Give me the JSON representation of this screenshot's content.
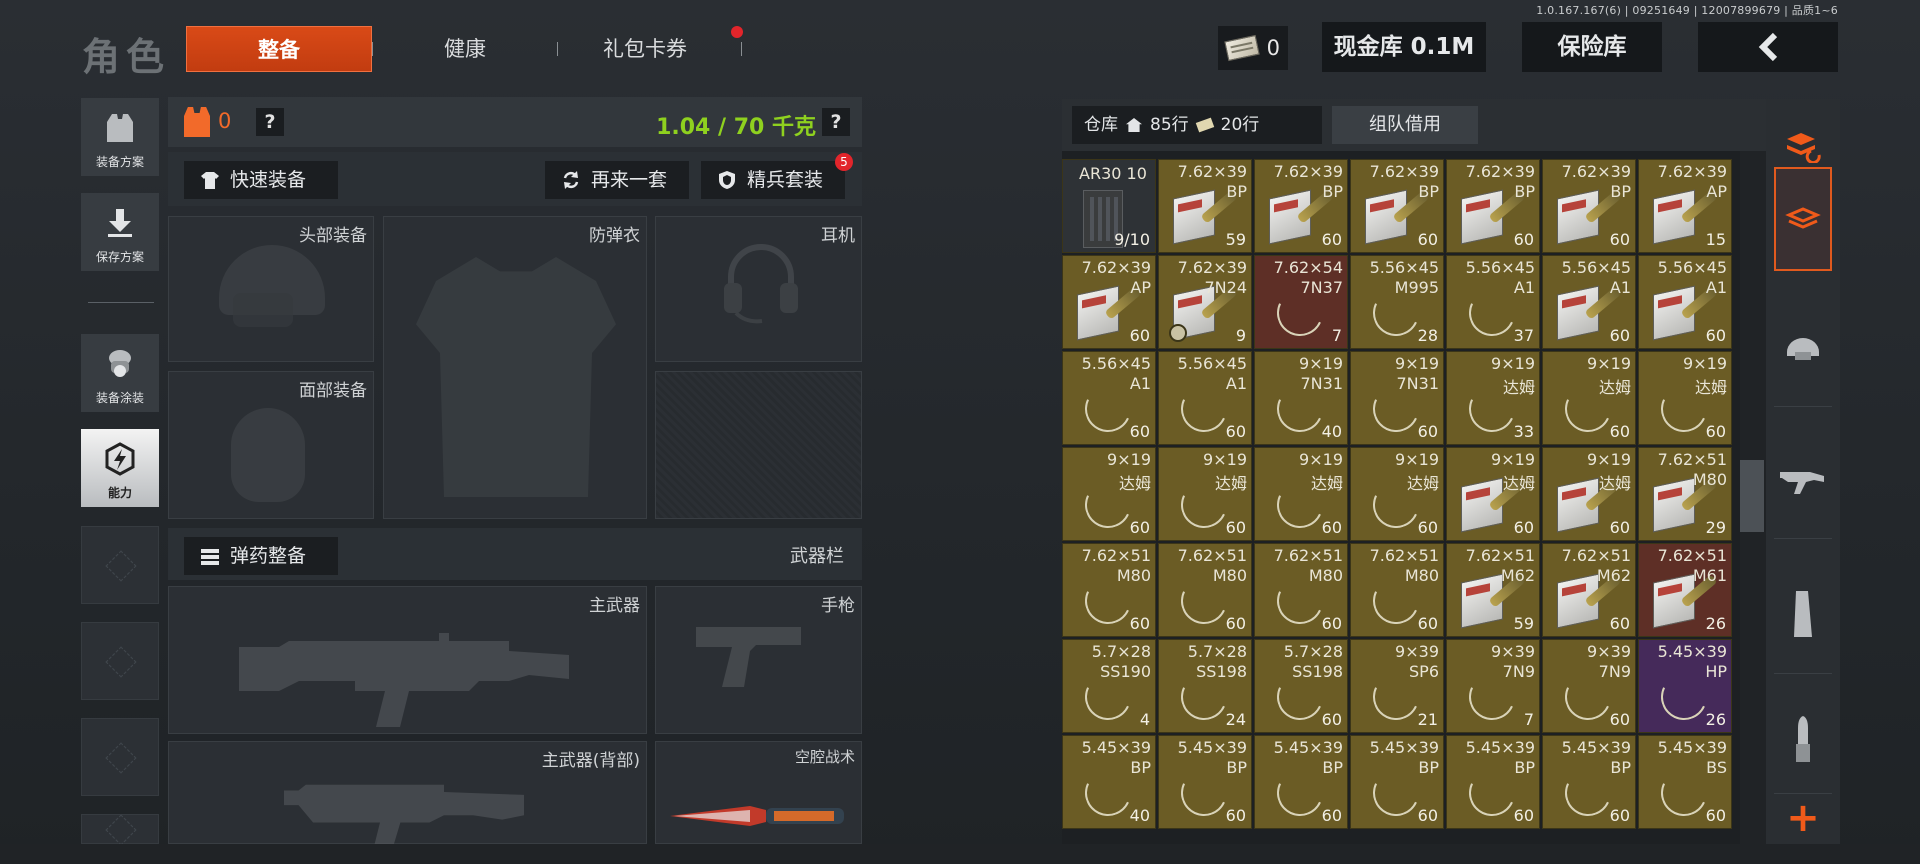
{
  "version_text": "1.0.167.167(6) | 09251649 | 12007899679 | 品质1~6",
  "header": {
    "page_title": "角色",
    "tabs": [
      {
        "label": "整备",
        "active": true
      },
      {
        "label": "健康",
        "active": false
      },
      {
        "label": "礼包卡券",
        "active": false,
        "has_notification": true
      }
    ],
    "money_value": "0",
    "cash_button": "现金库 0.1M",
    "safe_button": "保险库",
    "back_icon": "chevron-left-icon"
  },
  "left_rail": {
    "items": [
      {
        "label": "装备方案",
        "icon": "vest-icon"
      },
      {
        "label": "保存方案",
        "icon": "download-icon"
      },
      {
        "label": "装备涂装",
        "icon": "soldier-icon"
      },
      {
        "label": "能力",
        "icon": "ability-icon",
        "active": true
      }
    ]
  },
  "equipment": {
    "armor_count": "0",
    "help_label": "?",
    "weight": "1.04 / 70 千克",
    "quick_equip": "快速装备",
    "repeat_set": "再来一套",
    "elite_set": "精兵套装",
    "elite_badge": "5",
    "slots": {
      "head": "头部装备",
      "armor": "防弹衣",
      "headset": "耳机",
      "face": "面部装备"
    },
    "ammo_button": "弹药整备",
    "weapons_label": "武器栏",
    "weapon_slots": {
      "primary": "主武器",
      "pistol": "手枪",
      "primary_back": "主武器(背部)",
      "melee": "空腔战术"
    }
  },
  "warehouse": {
    "tab_label": "仓库",
    "rows_house": "85行",
    "rows_ticket": "20行",
    "borrow_label": "组队借用",
    "colors": {
      "gold": "#6b5c25",
      "gray": "#2e3236",
      "red": "#5e2f26",
      "purple": "#452a5a"
    },
    "items": [
      {
        "cal": "AR30",
        "type": "10",
        "qty": "9/10",
        "art": "mag",
        "color": "gray"
      },
      {
        "cal": "7.62×39",
        "type": "BP",
        "qty": "59",
        "art": "box",
        "color": "gold"
      },
      {
        "cal": "7.62×39",
        "type": "BP",
        "qty": "60",
        "art": "box",
        "color": "gold"
      },
      {
        "cal": "7.62×39",
        "type": "BP",
        "qty": "60",
        "art": "box",
        "color": "gold"
      },
      {
        "cal": "7.62×39",
        "type": "BP",
        "qty": "60",
        "art": "box",
        "color": "gold"
      },
      {
        "cal": "7.62×39",
        "type": "BP",
        "qty": "60",
        "art": "box",
        "color": "gold"
      },
      {
        "cal": "7.62×39",
        "type": "AP",
        "qty": "15",
        "art": "box",
        "color": "gold"
      },
      {
        "cal": "7.62×39",
        "type": "AP",
        "qty": "60",
        "art": "box",
        "color": "gold"
      },
      {
        "cal": "7.62×39",
        "type": "7N24",
        "qty": "9",
        "art": "box",
        "color": "gold",
        "badge": true
      },
      {
        "cal": "7.62×54",
        "type": "7N37",
        "qty": "7",
        "art": "ring",
        "color": "red"
      },
      {
        "cal": "5.56×45",
        "type": "M995",
        "qty": "28",
        "art": "ring",
        "color": "gold"
      },
      {
        "cal": "5.56×45",
        "type": "A1",
        "qty": "37",
        "art": "ring",
        "color": "gold"
      },
      {
        "cal": "5.56×45",
        "type": "A1",
        "qty": "60",
        "art": "box",
        "color": "gold"
      },
      {
        "cal": "5.56×45",
        "type": "A1",
        "qty": "60",
        "art": "box",
        "color": "gold"
      },
      {
        "cal": "5.56×45",
        "type": "A1",
        "qty": "60",
        "art": "ring",
        "color": "gold"
      },
      {
        "cal": "5.56×45",
        "type": "A1",
        "qty": "60",
        "art": "ring",
        "color": "gold"
      },
      {
        "cal": "9×19",
        "type": "7N31",
        "qty": "40",
        "art": "ring",
        "color": "gold"
      },
      {
        "cal": "9×19",
        "type": "7N31",
        "qty": "60",
        "art": "ring",
        "color": "gold"
      },
      {
        "cal": "9×19",
        "type": "达姆",
        "qty": "33",
        "art": "ring",
        "color": "gold"
      },
      {
        "cal": "9×19",
        "type": "达姆",
        "qty": "60",
        "art": "ring",
        "color": "gold"
      },
      {
        "cal": "9×19",
        "type": "达姆",
        "qty": "60",
        "art": "ring",
        "color": "gold"
      },
      {
        "cal": "9×19",
        "type": "达姆",
        "qty": "60",
        "art": "ring",
        "color": "gold"
      },
      {
        "cal": "9×19",
        "type": "达姆",
        "qty": "60",
        "art": "ring",
        "color": "gold"
      },
      {
        "cal": "9×19",
        "type": "达姆",
        "qty": "60",
        "art": "ring",
        "color": "gold"
      },
      {
        "cal": "9×19",
        "type": "达姆",
        "qty": "60",
        "art": "ring",
        "color": "gold"
      },
      {
        "cal": "9×19",
        "type": "达姆",
        "qty": "60",
        "art": "box",
        "color": "gold"
      },
      {
        "cal": "9×19",
        "type": "达姆",
        "qty": "60",
        "art": "box",
        "color": "gold"
      },
      {
        "cal": "7.62×51",
        "type": "M80",
        "qty": "29",
        "art": "box",
        "color": "gold"
      },
      {
        "cal": "7.62×51",
        "type": "M80",
        "qty": "60",
        "art": "ring",
        "color": "gold"
      },
      {
        "cal": "7.62×51",
        "type": "M80",
        "qty": "60",
        "art": "ring",
        "color": "gold"
      },
      {
        "cal": "7.62×51",
        "type": "M80",
        "qty": "60",
        "art": "ring",
        "color": "gold"
      },
      {
        "cal": "7.62×51",
        "type": "M80",
        "qty": "60",
        "art": "ring",
        "color": "gold"
      },
      {
        "cal": "7.62×51",
        "type": "M62",
        "qty": "59",
        "art": "box",
        "color": "gold"
      },
      {
        "cal": "7.62×51",
        "type": "M62",
        "qty": "60",
        "art": "box",
        "color": "gold"
      },
      {
        "cal": "7.62×51",
        "type": "M61",
        "qty": "26",
        "art": "box",
        "color": "red"
      },
      {
        "cal": "5.7×28",
        "type": "SS190",
        "qty": "4",
        "art": "ring",
        "color": "gold"
      },
      {
        "cal": "5.7×28",
        "type": "SS198",
        "qty": "24",
        "art": "ring",
        "color": "gold"
      },
      {
        "cal": "5.7×28",
        "type": "SS198",
        "qty": "60",
        "art": "ring",
        "color": "gold"
      },
      {
        "cal": "9×39",
        "type": "SP6",
        "qty": "21",
        "art": "ring",
        "color": "gold"
      },
      {
        "cal": "9×39",
        "type": "7N9",
        "qty": "7",
        "art": "ring",
        "color": "gold"
      },
      {
        "cal": "9×39",
        "type": "7N9",
        "qty": "60",
        "art": "ring",
        "color": "gold"
      },
      {
        "cal": "5.45×39",
        "type": "HP",
        "qty": "26",
        "art": "ring",
        "color": "purple"
      },
      {
        "cal": "5.45×39",
        "type": "BP",
        "qty": "40",
        "art": "ring",
        "color": "gold"
      },
      {
        "cal": "5.45×39",
        "type": "BP",
        "qty": "60",
        "art": "ring",
        "color": "gold"
      },
      {
        "cal": "5.45×39",
        "type": "BP",
        "qty": "60",
        "art": "ring",
        "color": "gold"
      },
      {
        "cal": "5.45×39",
        "type": "BP",
        "qty": "60",
        "art": "ring",
        "color": "gold"
      },
      {
        "cal": "5.45×39",
        "type": "BP",
        "qty": "60",
        "art": "ring",
        "color": "gold"
      },
      {
        "cal": "5.45×39",
        "type": "BP",
        "qty": "60",
        "art": "ring",
        "color": "gold"
      },
      {
        "cal": "5.45×39",
        "type": "BS",
        "qty": "60",
        "art": "ring",
        "color": "gold"
      }
    ]
  },
  "filter_rail": {
    "items": [
      {
        "icon": "stack-refresh-icon"
      },
      {
        "icon": "layers-icon",
        "active": true
      },
      {
        "icon": "helmet-icon"
      },
      {
        "icon": "rifle-icon"
      },
      {
        "icon": "magazine-icon"
      },
      {
        "icon": "bullet-icon"
      }
    ],
    "add_label": "+"
  }
}
